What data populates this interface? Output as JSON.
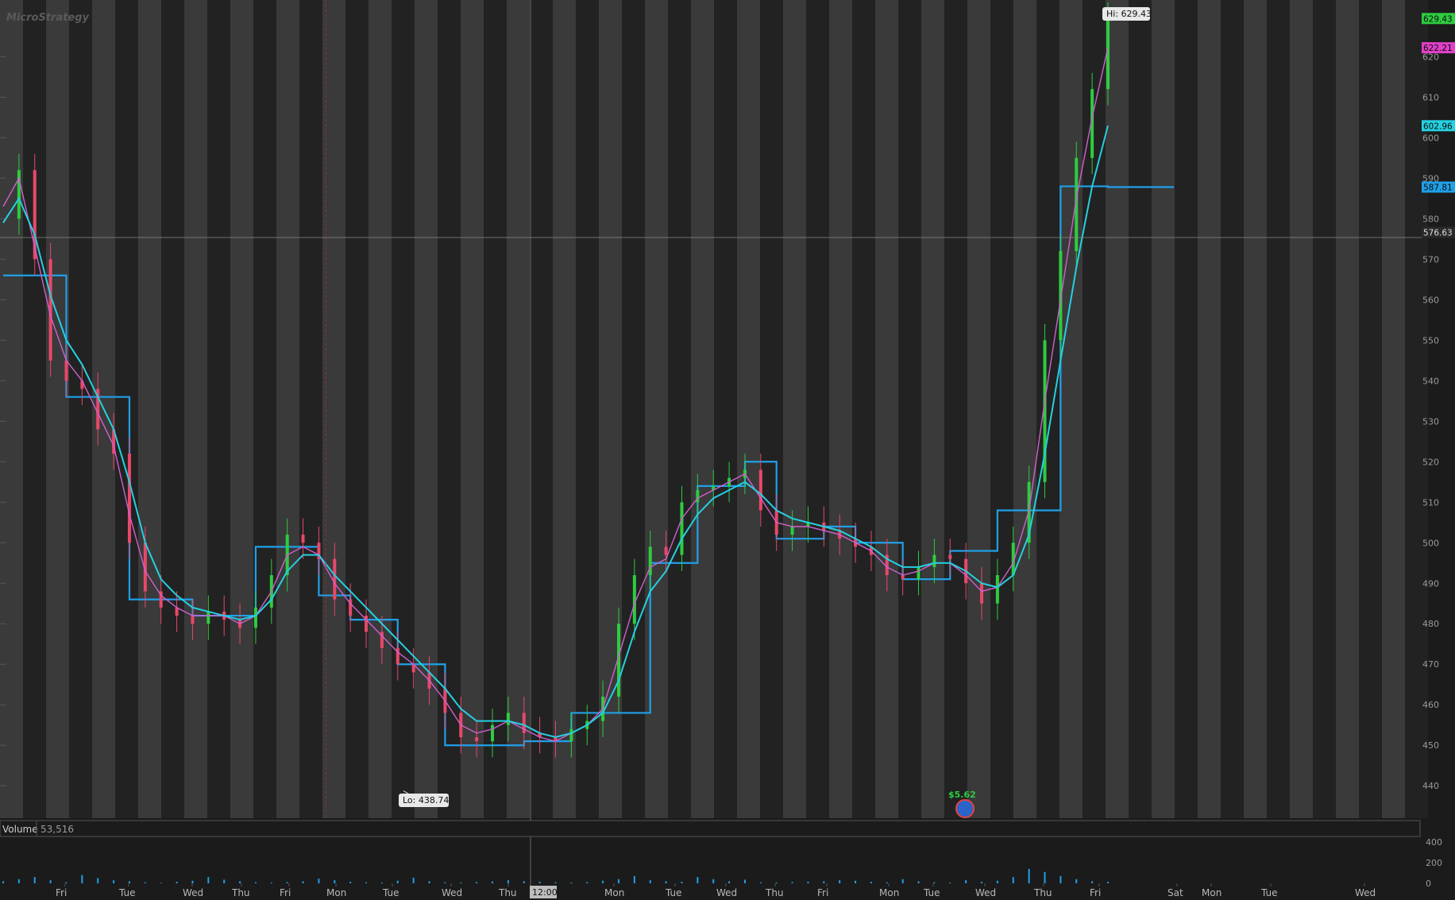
{
  "watermark": "MicroStrategy",
  "volume_panel": {
    "label": "Volume",
    "value": "53,516",
    "ticks": [
      "400",
      "200",
      "0"
    ],
    "tick_values": [
      400,
      200,
      0
    ]
  },
  "annotations": {
    "high": "Hi: 629.43",
    "low": "Lo: 438.74",
    "dividend": "$5.62",
    "crosshair_time": "12:00",
    "crosshair_price": "576.63"
  },
  "price_tags": [
    {
      "value": "629.43",
      "color": "#2ecc40"
    },
    {
      "value": "622.21",
      "color": "#e040c8"
    },
    {
      "value": "602.96",
      "color": "#25d0e0"
    },
    {
      "value": "587.81",
      "color": "#1fa0e8"
    },
    {
      "value": "576.63",
      "color": "#2a2a2a"
    }
  ],
  "colors": {
    "up": "#2ecc40",
    "down": "#e8486a",
    "ema_fast": "#d060d0",
    "ema_slow": "#25d0e0",
    "step": "#1fa0e8",
    "band_light": "#3a3a3a",
    "band_dark": "#222222"
  },
  "chart_data": {
    "type": "line",
    "title": "",
    "xlabel": "",
    "ylabel": "",
    "ylim": [
      432,
      634
    ],
    "grid": false,
    "y_ticks": [
      440,
      450,
      460,
      470,
      480,
      490,
      500,
      510,
      520,
      530,
      540,
      550,
      560,
      570,
      580,
      590,
      600,
      610,
      620
    ],
    "x_ticks": [
      "Fri",
      "Tue",
      "Wed",
      "Thu",
      "Fri",
      "Mon",
      "Tue",
      "Wed",
      "Thu",
      "Mon",
      "Tue",
      "Wed",
      "Thu",
      "Fri",
      "Mon",
      "Tue",
      "Wed",
      "Thu",
      "Fri",
      "Sat",
      "Mon",
      "Tue",
      "Wed"
    ],
    "series": [
      {
        "name": "",
        "values": [
          580,
          592,
          570,
          545,
          540,
          538,
          528,
          522,
          500,
          488,
          484,
          482,
          480,
          483,
          481,
          479,
          484,
          492,
          502,
          500,
          496,
          486,
          482,
          478,
          474,
          470,
          468,
          464,
          458,
          452,
          451,
          455,
          458,
          453,
          452,
          451,
          454,
          456,
          462,
          480,
          492,
          499,
          497,
          510,
          513,
          514,
          516,
          518,
          508,
          502,
          504,
          505,
          503,
          501,
          499,
          497,
          492,
          491,
          494,
          497,
          496,
          490,
          485,
          492,
          500,
          515,
          550,
          572,
          595,
          612,
          629.43
        ]
      },
      {
        "name": "",
        "values": [
          583,
          590,
          573,
          556,
          545,
          540,
          532,
          524,
          507,
          493,
          487,
          484,
          482,
          482,
          482,
          480,
          482,
          488,
          497,
          499,
          497,
          490,
          485,
          481,
          477,
          473,
          470,
          466,
          461,
          455,
          453,
          454,
          456,
          454,
          452,
          451,
          453,
          455,
          459,
          472,
          485,
          494,
          496,
          506,
          511,
          513,
          515,
          517,
          511,
          505,
          504,
          504,
          503,
          502,
          500,
          498,
          494,
          492,
          493,
          495,
          495,
          492,
          488,
          489,
          495,
          508,
          535,
          560,
          585,
          605,
          622.21
        ]
      },
      {
        "name": "",
        "values": [
          579,
          585,
          576,
          561,
          550,
          544,
          536,
          528,
          515,
          500,
          491,
          487,
          484,
          483,
          482,
          481,
          482,
          486,
          493,
          497,
          497,
          492,
          488,
          484,
          480,
          476,
          472,
          468,
          464,
          459,
          456,
          456,
          456,
          455,
          453,
          452,
          453,
          455,
          458,
          466,
          478,
          488,
          493,
          501,
          507,
          511,
          513,
          515,
          512,
          508,
          506,
          505,
          504,
          503,
          501,
          499,
          496,
          494,
          494,
          495,
          495,
          493,
          490,
          489,
          492,
          502,
          522,
          545,
          568,
          588,
          602.96
        ]
      },
      {
        "name": "",
        "values": [
          566,
          566,
          566,
          566,
          536,
          536,
          536,
          536,
          486,
          486,
          486,
          486,
          482,
          482,
          482,
          482,
          499,
          499,
          499,
          499,
          487,
          487,
          481,
          481,
          481,
          470,
          470,
          470,
          450,
          450,
          450,
          450,
          450,
          451,
          451,
          451,
          458,
          458,
          458,
          458,
          458,
          495,
          495,
          495,
          514,
          514,
          514,
          520,
          520,
          501,
          501,
          501,
          504,
          504,
          500,
          500,
          500,
          491,
          491,
          491,
          498,
          498,
          498,
          508,
          508,
          508,
          508,
          588,
          588,
          588,
          587.81
        ]
      }
    ],
    "high": 629.43,
    "low": 438.74,
    "volume": [
      20,
      40,
      60,
      30,
      10,
      80,
      50,
      30,
      20,
      10,
      5,
      15,
      25,
      60,
      35,
      20,
      10,
      8,
      12,
      20,
      45,
      30,
      15,
      10,
      8,
      25,
      55,
      20,
      10,
      8,
      12,
      18,
      30,
      20,
      15,
      10,
      8,
      12,
      25,
      40,
      70,
      30,
      20,
      15,
      60,
      40,
      20,
      35,
      10,
      8,
      12,
      15,
      20,
      30,
      25,
      15,
      10,
      40,
      20,
      10,
      8,
      30,
      15,
      25,
      60,
      140,
      110,
      70,
      40,
      20,
      15
    ]
  }
}
